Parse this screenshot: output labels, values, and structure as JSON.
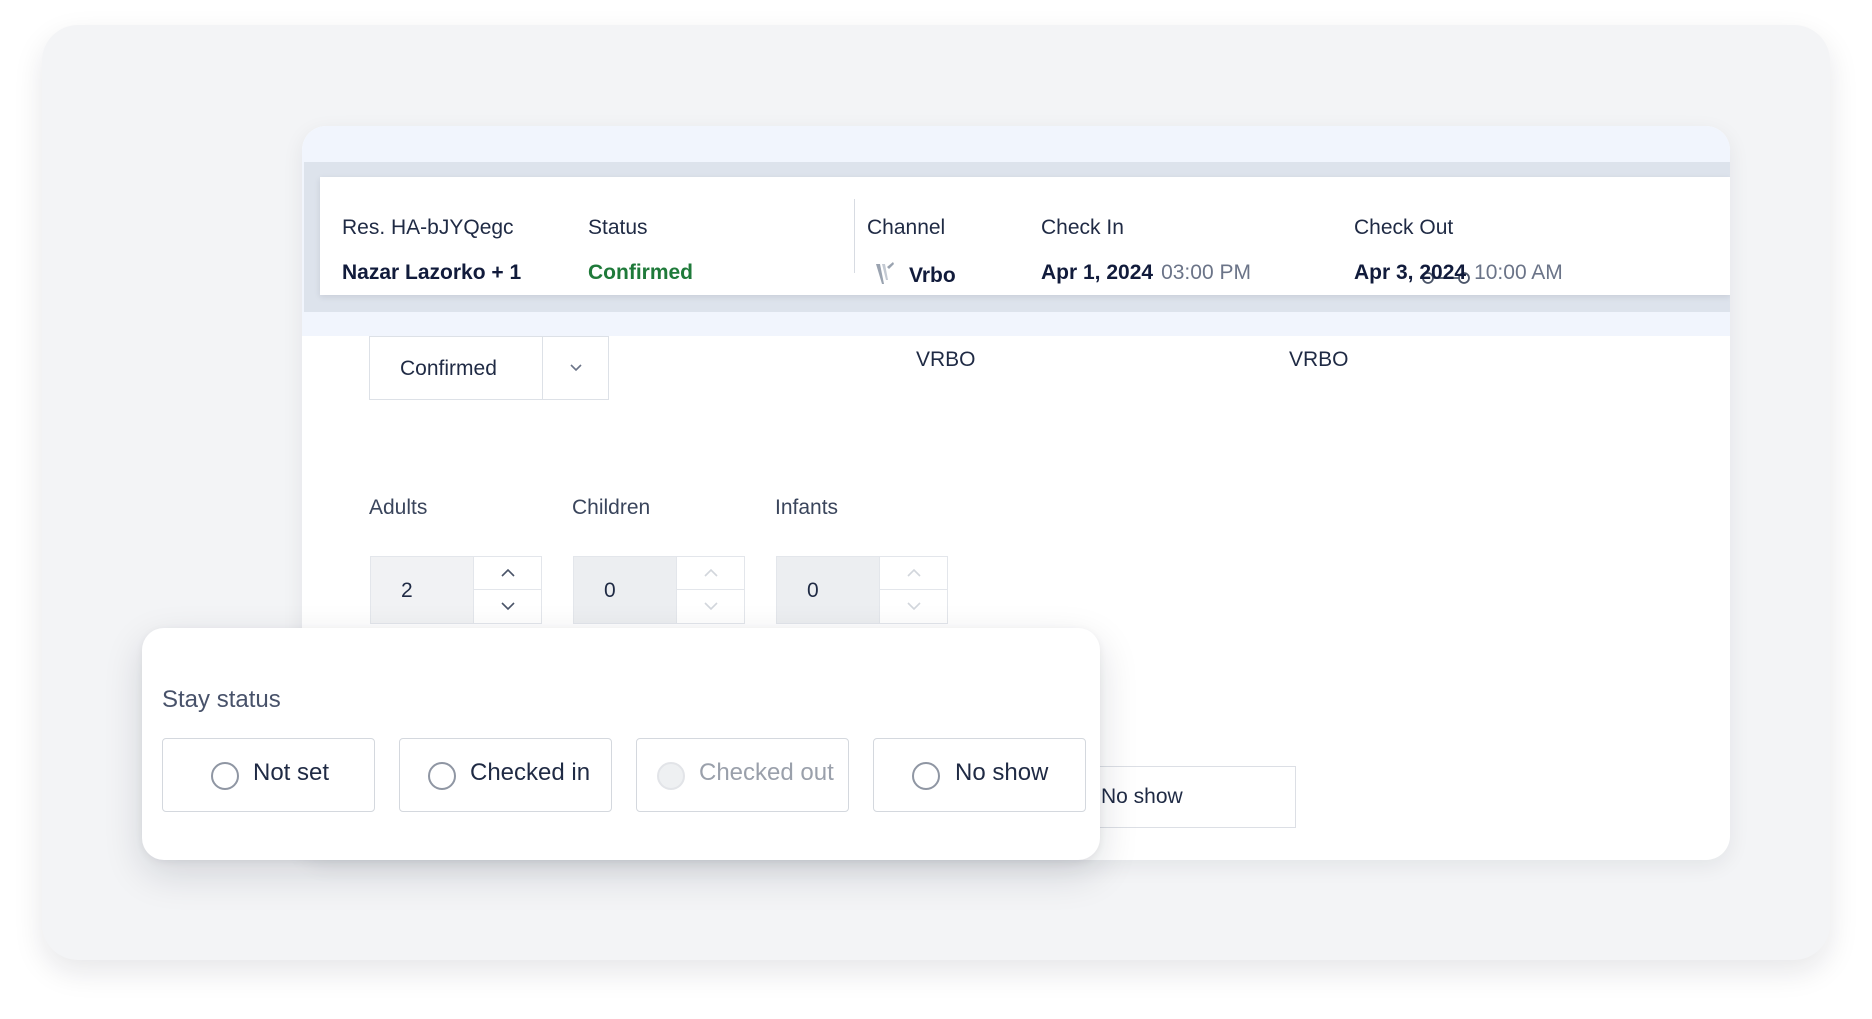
{
  "reservation": {
    "res_label": "Res. HA-bJYQegc",
    "guest_name": "Nazar Lazorko + 1",
    "status_label": "Status",
    "status_value": "Confirmed",
    "channel_label": "Channel",
    "channel_value": "Vrbo",
    "check_in_label": "Check In",
    "check_in_date": "Apr 1, 2024",
    "check_in_time": "03:00 PM",
    "check_out_label": "Check Out",
    "check_out_date": "Apr 3, 2024",
    "check_out_time": "10:00 AM"
  },
  "form": {
    "status_select_value": "Confirmed",
    "channel_1": "VRBO",
    "channel_2": "VRBO",
    "adults_label": "Adults",
    "adults_value": "2",
    "children_label": "Children",
    "children_value": "0",
    "infants_label": "Infants",
    "infants_value": "0",
    "background_no_show": "No show"
  },
  "stay_status": {
    "title": "Stay status",
    "options": [
      {
        "label": "Not set",
        "disabled": false
      },
      {
        "label": "Checked in",
        "disabled": false
      },
      {
        "label": "Checked out",
        "disabled": true
      },
      {
        "label": "No show",
        "disabled": false
      }
    ]
  },
  "colors": {
    "confirmed_green": "#1f7a3a",
    "backdrop": "#f3f4f6",
    "header_band": "#dde3ec"
  }
}
